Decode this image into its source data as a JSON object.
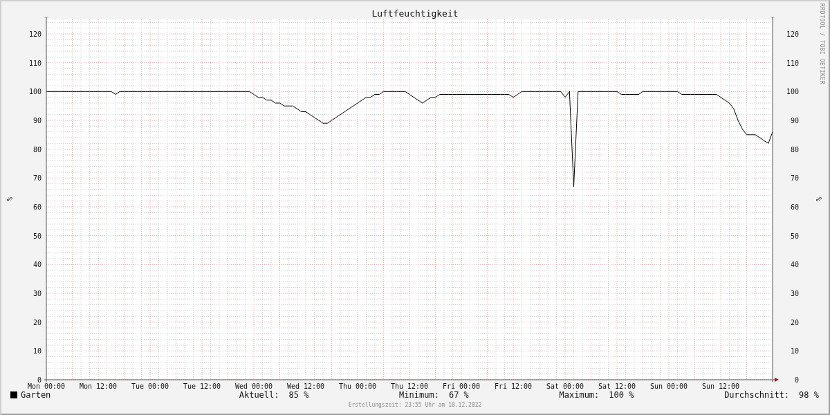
{
  "chart": {
    "credit": "RRDTOOL / TOBI OETIKER",
    "chart_data": {
      "type": "line",
      "title": "Luftfeuchtigkeit",
      "ylabel": "%",
      "categories": [
        "Mon 00:00",
        null,
        null,
        null,
        null,
        null,
        null,
        null,
        null,
        null,
        null,
        null,
        "Mon 12:00",
        null,
        null,
        null,
        null,
        null,
        null,
        null,
        null,
        null,
        null,
        null,
        "Tue 00:00",
        null,
        null,
        null,
        null,
        null,
        null,
        null,
        null,
        null,
        null,
        null,
        "Tue 12:00",
        null,
        null,
        null,
        null,
        null,
        null,
        null,
        null,
        null,
        null,
        null,
        "Wed 00:00",
        null,
        null,
        null,
        null,
        null,
        null,
        null,
        null,
        null,
        null,
        null,
        "Wed 12:00",
        null,
        null,
        null,
        null,
        null,
        null,
        null,
        null,
        null,
        null,
        null,
        "Thu 00:00",
        null,
        null,
        null,
        null,
        null,
        null,
        null,
        null,
        null,
        null,
        null,
        "Thu 12:00",
        null,
        null,
        null,
        null,
        null,
        null,
        null,
        null,
        null,
        null,
        null,
        "Fri 00:00",
        null,
        null,
        null,
        null,
        null,
        null,
        null,
        null,
        null,
        null,
        null,
        "Fri 12:00",
        null,
        null,
        null,
        null,
        null,
        null,
        null,
        null,
        null,
        null,
        null,
        "Sat 00:00",
        null,
        null,
        null,
        null,
        null,
        null,
        null,
        null,
        null,
        null,
        null,
        "Sat 12:00",
        null,
        null,
        null,
        null,
        null,
        null,
        null,
        null,
        null,
        null,
        null,
        "Sun 00:00",
        null,
        null,
        null,
        null,
        null,
        null,
        null,
        null,
        null,
        null,
        null,
        "Sun 12:00",
        null,
        null,
        null,
        null,
        null,
        null,
        null,
        null,
        null,
        null,
        null,
        null
      ],
      "series": [
        {
          "name": "Garten",
          "color": "#000000",
          "values": [
            100,
            100,
            100,
            100,
            100,
            100,
            100,
            100,
            100,
            100,
            100,
            100,
            100,
            100,
            100,
            100,
            99,
            100,
            100,
            100,
            100,
            100,
            100,
            100,
            100,
            100,
            100,
            100,
            100,
            100,
            100,
            100,
            100,
            100,
            100,
            100,
            100,
            100,
            100,
            100,
            100,
            100,
            100,
            100,
            100,
            100,
            100,
            100,
            99,
            98,
            98,
            97,
            97,
            96,
            96,
            95,
            95,
            95,
            94,
            93,
            93,
            92,
            91,
            90,
            89,
            89,
            90,
            91,
            92,
            93,
            94,
            95,
            96,
            97,
            98,
            98,
            99,
            99,
            100,
            100,
            100,
            100,
            100,
            100,
            99,
            98,
            97,
            96,
            97,
            98,
            98,
            99,
            99,
            99,
            99,
            99,
            99,
            99,
            99,
            99,
            99,
            99,
            99,
            99,
            99,
            99,
            99,
            99,
            98,
            99,
            100,
            100,
            100,
            100,
            100,
            100,
            100,
            100,
            100,
            100,
            98,
            100,
            67,
            100,
            100,
            100,
            100,
            100,
            100,
            100,
            100,
            100,
            100,
            99,
            99,
            99,
            99,
            99,
            100,
            100,
            100,
            100,
            100,
            100,
            100,
            100,
            100,
            99,
            99,
            99,
            99,
            99,
            99,
            99,
            99,
            99,
            98,
            97,
            96,
            94,
            90,
            87,
            85,
            85,
            85,
            84,
            83,
            82,
            86
          ]
        }
      ],
      "grid": true,
      "ylim": [
        0,
        125
      ],
      "yticks": [
        0,
        10,
        20,
        30,
        40,
        50,
        60,
        70,
        80,
        90,
        100,
        110,
        120
      ]
    },
    "right_axis": {
      "label": "%",
      "ticks": [
        "120",
        "110",
        "100",
        "90",
        "80",
        "70",
        "60",
        "50",
        "40",
        "30",
        "20",
        "10",
        "0"
      ]
    }
  },
  "legend": {
    "stats": [
      {
        "label": "Aktuell:",
        "value": "85 %"
      },
      {
        "label": "Minimum:",
        "value": "67 %"
      },
      {
        "label": "Maximum:",
        "value": "100 %"
      },
      {
        "label": "Durchschnitt:",
        "value": "98 %"
      }
    ]
  },
  "footer": "Erstellungszeit: 23:55 Uhr am 18.12.2022"
}
